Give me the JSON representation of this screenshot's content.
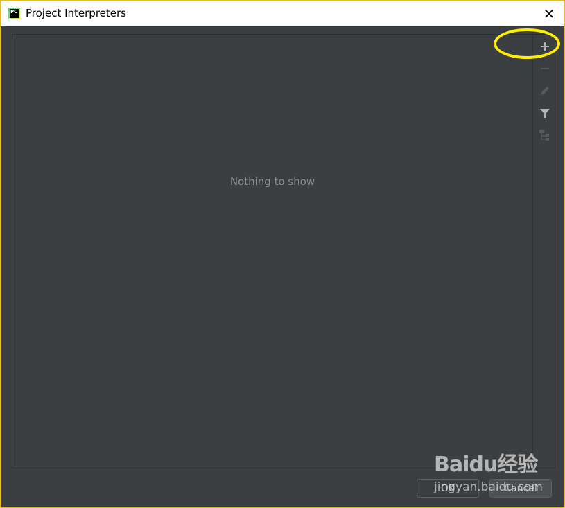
{
  "window": {
    "title": "Project Interpreters",
    "app_icon_text": "PC"
  },
  "list": {
    "empty_text": "Nothing to show"
  },
  "toolbar": {
    "items": [
      {
        "icon": "plus-icon",
        "enabled": true
      },
      {
        "icon": "minus-icon",
        "enabled": false
      },
      {
        "icon": "pencil-icon",
        "enabled": false
      },
      {
        "icon": "filter-icon",
        "enabled": true
      },
      {
        "icon": "tree-icon",
        "enabled": false
      }
    ]
  },
  "buttons": {
    "ok": "OK",
    "cancel": "Cancel"
  },
  "annotation": {
    "color": "#ffee00"
  },
  "watermark": {
    "logo": "Baidu经验",
    "url": "jingyan.baidu.com"
  }
}
